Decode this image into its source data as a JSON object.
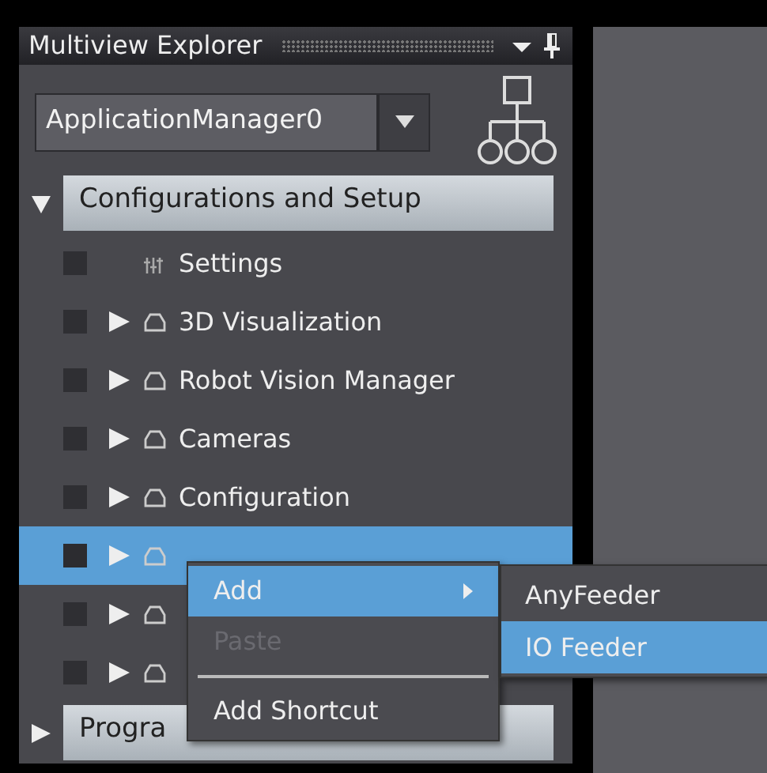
{
  "panel": {
    "title": "Multiview Explorer",
    "application_select": {
      "value": "ApplicationManager0"
    },
    "sections": [
      {
        "label": "Configurations and Setup",
        "expanded": true,
        "items": [
          {
            "kind": "settings",
            "label": "Settings",
            "checked": false,
            "selected": false
          },
          {
            "kind": "node",
            "label": "3D Visualization",
            "checked": false,
            "selected": false
          },
          {
            "kind": "node",
            "label": "Robot Vision Manager",
            "checked": false,
            "selected": false
          },
          {
            "kind": "node",
            "label": "Cameras",
            "checked": false,
            "selected": false
          },
          {
            "kind": "node",
            "label": "Configuration",
            "checked": false,
            "selected": false
          },
          {
            "kind": "node",
            "checked": false,
            "selected": true
          },
          {
            "kind": "node",
            "checked": false,
            "selected": false
          },
          {
            "kind": "node",
            "checked": false,
            "selected": false
          }
        ]
      },
      {
        "label": "Progra",
        "expanded": false
      }
    ]
  },
  "context_menu": {
    "items": [
      {
        "kind": "item",
        "label": "Add",
        "submenu": true,
        "selected": true,
        "disabled": false
      },
      {
        "kind": "item",
        "label": "Paste",
        "submenu": false,
        "selected": false,
        "disabled": true
      },
      {
        "kind": "separator"
      },
      {
        "kind": "item",
        "label": "Add Shortcut",
        "submenu": false,
        "selected": false,
        "disabled": false
      }
    ]
  },
  "submenu": {
    "items": [
      {
        "label": "AnyFeeder",
        "selected": false
      },
      {
        "label": "IO Feeder",
        "selected": true
      }
    ]
  }
}
